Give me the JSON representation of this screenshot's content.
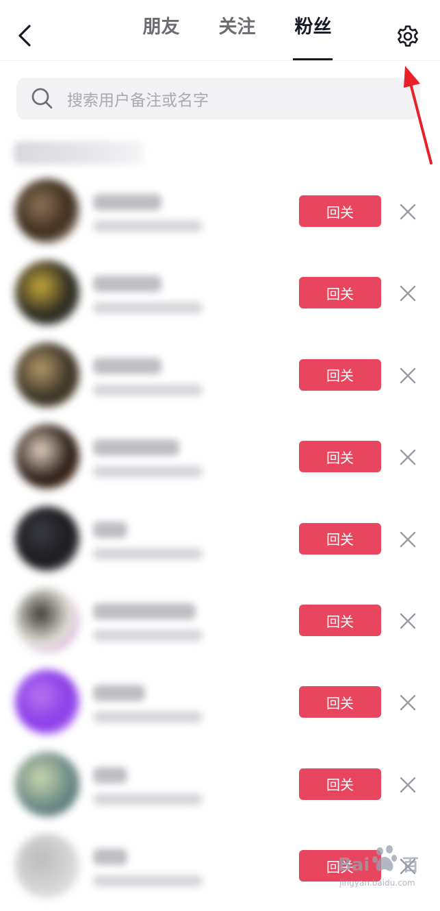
{
  "header": {
    "tabs": [
      {
        "label": "朋友",
        "active": false
      },
      {
        "label": "关注",
        "active": false
      },
      {
        "label": "粉丝",
        "active": true
      }
    ],
    "back_icon": "chevron-left-icon",
    "settings_icon": "gear-icon"
  },
  "search": {
    "placeholder": "搜索用户备注或名字",
    "icon": "search-icon"
  },
  "followers": {
    "button_label": "回关",
    "remove_icon": "close-icon",
    "rows": [
      {
        "avatar_colors": [
          "#3a2a1c",
          "#8c7356",
          "#f0e6da"
        ],
        "name_width": 100
      },
      {
        "avatar_colors": [
          "#2b2a22",
          "#c8a93a",
          "#55524a"
        ],
        "name_width": 100
      },
      {
        "avatar_colors": [
          "#3a3328",
          "#b39a66",
          "#6e5c3c"
        ],
        "name_width": 100
      },
      {
        "avatar_colors": [
          "#2a1e18",
          "#e2d2c0",
          "#7a4a2c"
        ],
        "name_width": 126
      },
      {
        "avatar_colors": [
          "#1a1a1e",
          "#3a3a42",
          "#6a6a72"
        ],
        "name_width": 50
      },
      {
        "avatar_colors": [
          "#e7e4de",
          "#3a3a32",
          "#c27ad8"
        ],
        "name_width": 150
      },
      {
        "avatar_colors": [
          "#8a3ae8",
          "#b574f0",
          "#d9a6f5"
        ],
        "name_width": 76
      },
      {
        "avatar_colors": [
          "#6d8a86",
          "#c9d6b0",
          "#3f5a60"
        ],
        "name_width": 50
      },
      {
        "avatar_colors": [
          "#d5d5d5",
          "#bdbdbd",
          "#ececec"
        ],
        "name_width": 50
      }
    ]
  },
  "colors": {
    "accent": "#e8455f",
    "annotation": "#e8202a",
    "active_tab": "#161823",
    "inactive_tab": "#6b6c70"
  },
  "watermark": {
    "brand": "Bai",
    "brand_tail": "百",
    "url": "jingyan.baidu.com"
  }
}
